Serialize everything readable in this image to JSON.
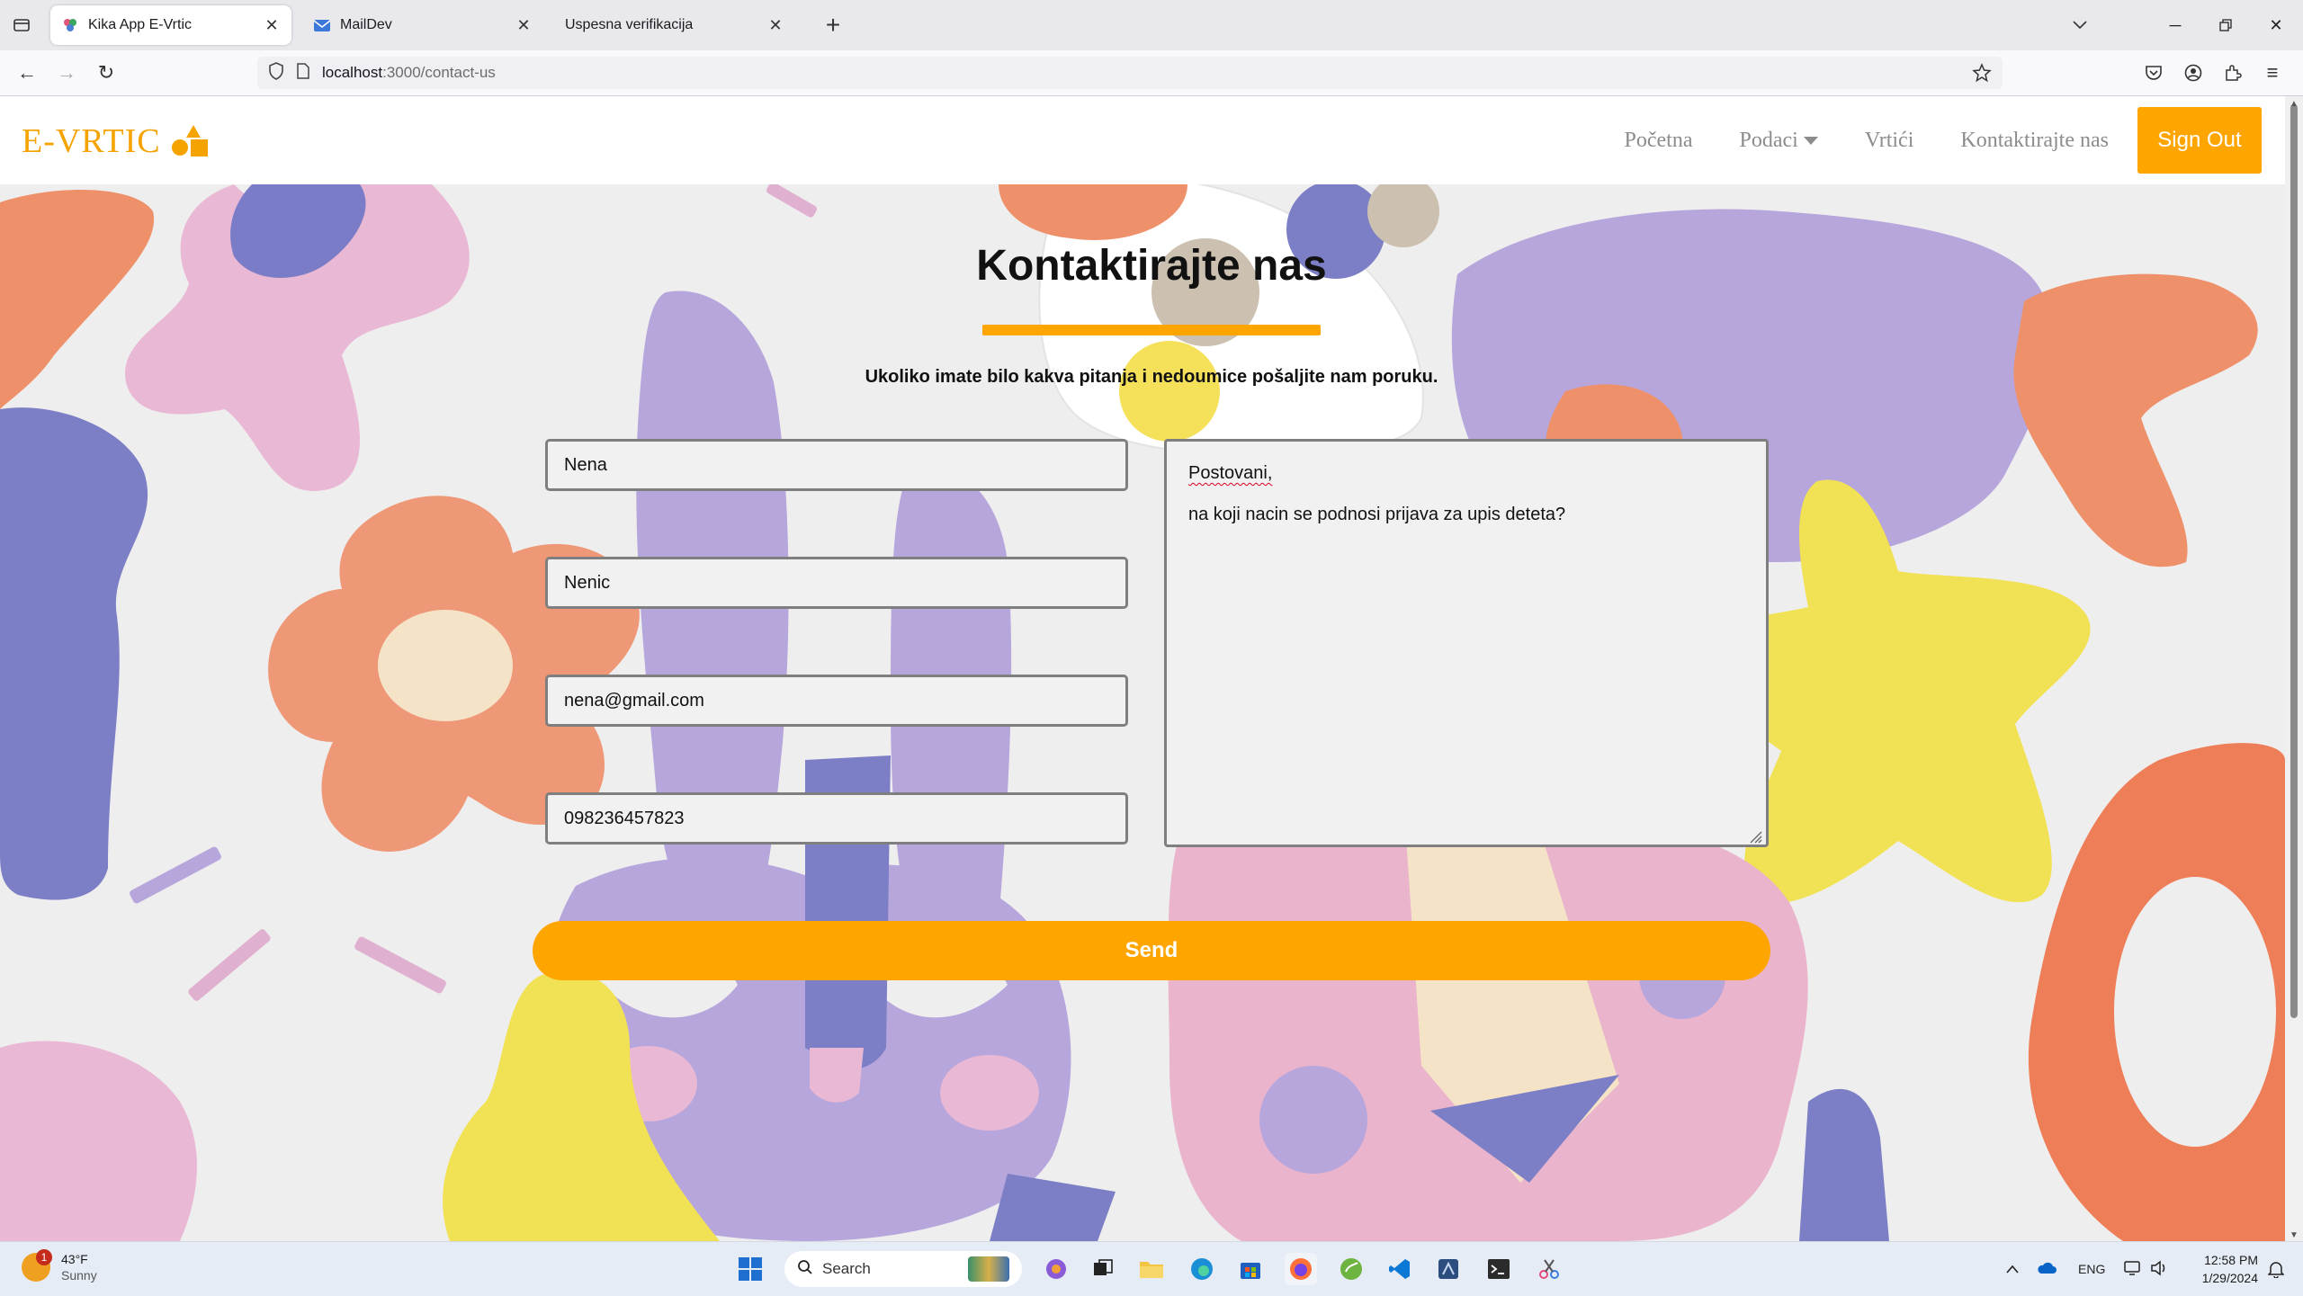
{
  "browser": {
    "tabs": [
      {
        "title": "Kika App E-Vrtic",
        "active": true,
        "icon": "flower-icon"
      },
      {
        "title": "MailDev",
        "active": false,
        "icon": "mail-icon"
      },
      {
        "title": "Uspesna verifikacija",
        "active": false,
        "icon": ""
      }
    ],
    "url_host": "localhost",
    "url_path": ":3000/contact-us"
  },
  "site": {
    "logo_text": "E-VRTIC",
    "nav": {
      "home": "Početna",
      "data": "Podaci",
      "kindergartens": "Vrtići",
      "contact": "Kontaktirajte nas"
    },
    "sign_out": "Sign Out",
    "accent_color": "#ffa500"
  },
  "contact": {
    "title": "Kontaktirajte nas",
    "subtitle": "Ukoliko imate bilo kakva pitanja i nedoumice pošaljite nam poruku.",
    "first_name": "Nena",
    "last_name": "Nenic",
    "email": "nena@gmail.com",
    "phone": "098236457823",
    "message_line1": "Postovani,",
    "message_line2": "na koji nacin se podnosi prijava za upis deteta?",
    "send_label": "Send"
  },
  "taskbar": {
    "weather_temp": "43°F",
    "weather_cond": "Sunny",
    "weather_badge": "1",
    "search_label": "Search",
    "language": "ENG",
    "time": "12:58 PM",
    "date": "1/29/2024"
  }
}
